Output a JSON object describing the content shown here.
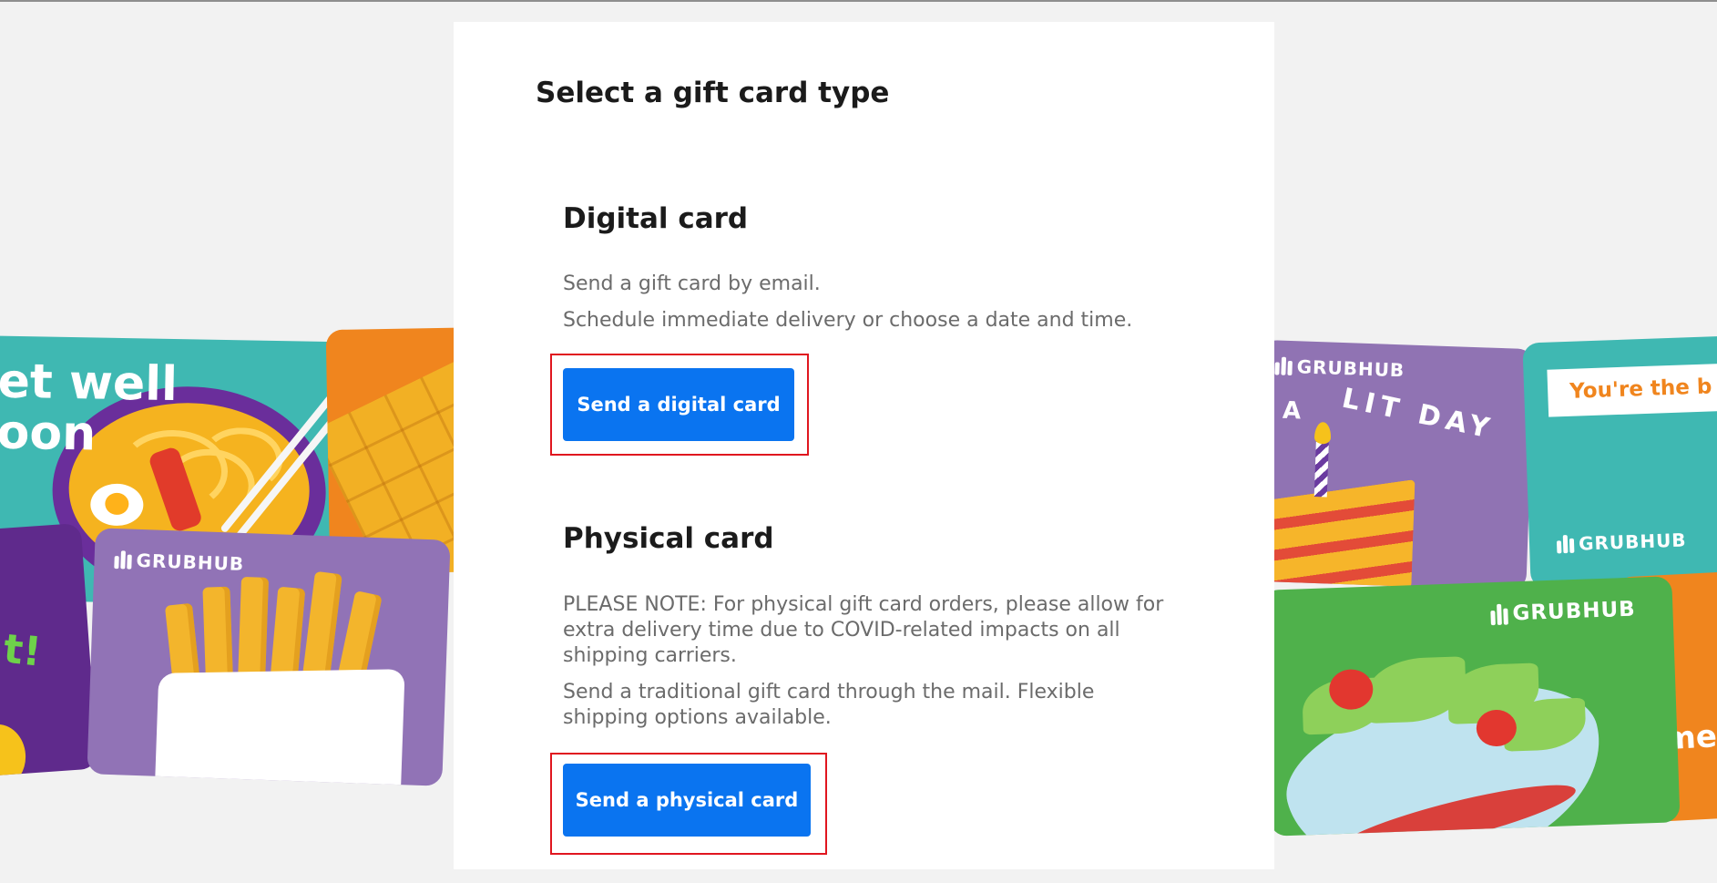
{
  "page": {
    "title": "Select a gift card type"
  },
  "digital": {
    "heading": "Digital card",
    "line1": "Send a gift card by email.",
    "line2": "Schedule immediate delivery or choose a date and time.",
    "button_label": "Send a digital card"
  },
  "physical": {
    "heading": "Physical card",
    "note": "PLEASE NOTE: For physical gift card orders, please allow for extra delivery time due to COVID-related impacts on all shipping carriers.",
    "description": "Send a traditional gift card through the mail. Flexible shipping options available.",
    "button_label": "Send a physical card"
  },
  "decor": {
    "brand": "GRUBHUB",
    "card_get_well": "et well\noon",
    "card_lit_a": "A",
    "card_lit_day": "LIT DAY",
    "card_youre": "You're the b",
    "card_partial": "me",
    "card_bang": "t!"
  },
  "colors": {
    "primary_button": "#0a74f0",
    "highlight_outline": "#e0161f",
    "panel_bg": "#ffffff",
    "page_bg": "#f2f2f2"
  }
}
